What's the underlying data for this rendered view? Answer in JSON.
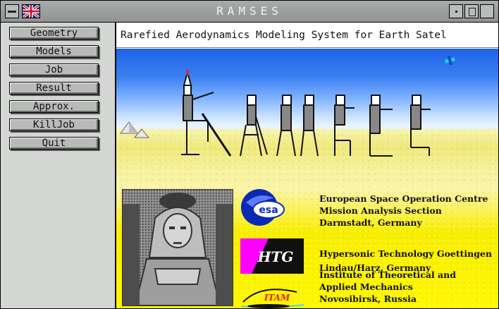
{
  "window": {
    "title": "RAMSES",
    "icons": [
      "window-menu-icon",
      "union-jack-flag-icon",
      "minimize-icon",
      "maximize-icon",
      "close-icon"
    ]
  },
  "sidebar": {
    "buttons": [
      {
        "label": "Geometry"
      },
      {
        "label": "Models"
      },
      {
        "label": "Job"
      },
      {
        "label": "Result"
      },
      {
        "label": "Approx."
      },
      {
        "label": "KillJob"
      },
      {
        "label": "Quit"
      }
    ]
  },
  "main": {
    "heading": "Rarefied Aerodynamics Modeling System for Earth Satel",
    "logos": [
      {
        "icon": "esa-logo-icon",
        "text": "esa"
      },
      {
        "icon": "htg-logo-icon",
        "text": "HTG"
      },
      {
        "icon": "itam-logo-icon",
        "text": "ITAM"
      }
    ],
    "institutions": [
      {
        "lines": [
          "European Space Operation Centre",
          "Mission Analysis Section",
          "Darmstadt, Germany"
        ]
      },
      {
        "lines": [
          "Hypersonic Technology Goettingen",
          "Lindau/Harz, Germany"
        ]
      },
      {
        "lines": [
          "Institute of Theoretical and",
          "Applied Mechanics",
          "Novosibirsk, Russia"
        ]
      }
    ]
  }
}
